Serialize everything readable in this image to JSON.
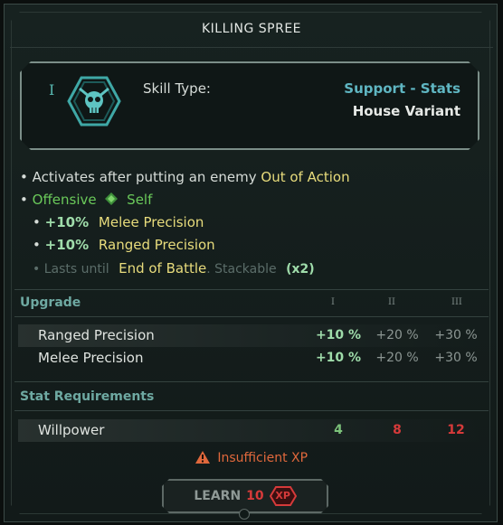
{
  "title": "KILLING SPREE",
  "skill": {
    "rank": "I",
    "icon": "skull-crossed-swords-icon",
    "type_label": "Skill Type:",
    "type_value": "Support - Stats",
    "variant": "House Variant"
  },
  "effects": {
    "line1_prefix": "Activates after putting an enemy",
    "line1_highlight": "Out of Action",
    "offensive": "Offensive",
    "self": "Self",
    "melee_value": "+10%",
    "melee_label": "Melee Precision",
    "ranged_value": "+10%",
    "ranged_label": "Ranged Precision",
    "lasts_prefix": "Lasts until",
    "lasts_highlight": "End of Battle",
    "stackable_sep": ".",
    "stackable": "Stackable",
    "stack_count": "(x2)"
  },
  "upgrade": {
    "heading": "Upgrade",
    "levels": [
      "I",
      "II",
      "III"
    ],
    "rows": [
      {
        "label": "Ranged Precision",
        "values": [
          "+10 %",
          "+20 %",
          "+30 %"
        ]
      },
      {
        "label": "Melee Precision",
        "values": [
          "+10 %",
          "+20 %",
          "+30 %"
        ]
      }
    ]
  },
  "requirements": {
    "heading": "Stat Requirements",
    "rows": [
      {
        "label": "Willpower",
        "values": [
          "4",
          "8",
          "12"
        ]
      }
    ]
  },
  "warning": {
    "icon": "warning-triangle-icon",
    "text": "Insufficient XP"
  },
  "learn": {
    "label": "LEARN",
    "cost": "10",
    "currency": "XP"
  },
  "colors": {
    "accent_teal": "#5fb6c2",
    "highlight_yellow": "#e8dc7c",
    "green": "#6ac95a",
    "warning_orange": "#e0683c",
    "insufficient_red": "#d63a3a"
  }
}
